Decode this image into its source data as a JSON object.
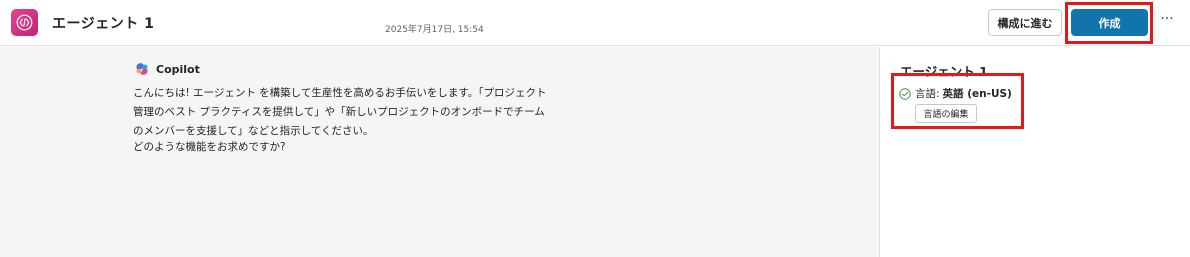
{
  "header": {
    "app_icon": "code-brackets-icon",
    "title": "エージェント 1",
    "configure_label": "構成に進む",
    "create_label": "作成",
    "more_label": "···"
  },
  "chat": {
    "timestamp": "2025年7月17日, 15:54",
    "bot_name": "Copilot",
    "bot_icon": "copilot-logo-icon",
    "message_lines": [
      "こんにちは! エージェント を構築して生産性を高めるお手伝いをします。「プロジェクト",
      "管理のベスト プラクティスを提供して」や「新しいプロジェクトのオンボードでチーム",
      "のメンバーを支援して」などと指示してください。"
    ],
    "question": "どのような機能をお求めですか?"
  },
  "side_panel": {
    "title": "エージェント 1",
    "language_label": "言語:",
    "language_value": "英語 (en-US)",
    "language_status_icon": "check-circle-icon",
    "edit_language_label": "言語の編集"
  },
  "colors": {
    "primary_button": "#1274ac",
    "highlight_border": "#e11919",
    "app_icon_bg": "#d0337f",
    "chat_bg": "#f5f5f5",
    "check_green": "#3c9b54"
  }
}
